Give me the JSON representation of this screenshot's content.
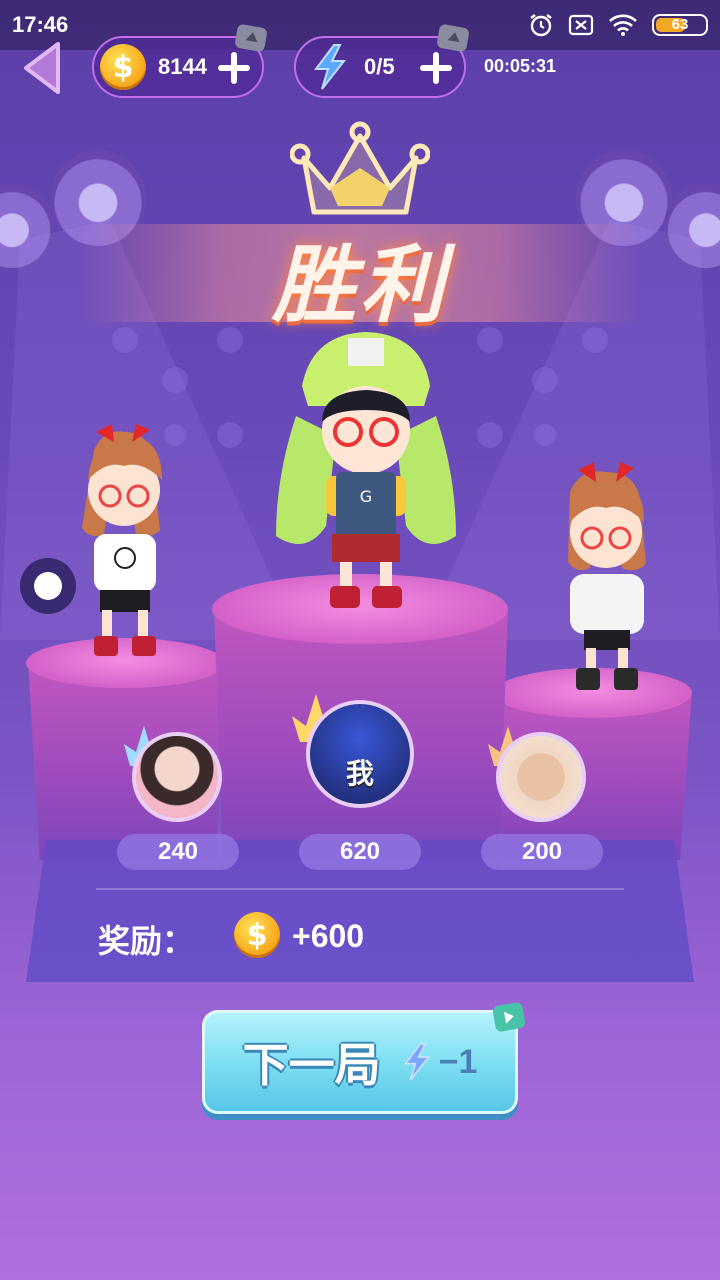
{
  "status_bar": {
    "time": "17:46",
    "battery": "63",
    "battery_level": 0.63
  },
  "top_bar": {
    "coins": "8144",
    "energy": "0/5",
    "timer": "00:05:31",
    "icons": [
      "back-arrow-icon",
      "coin-icon",
      "plus-icon",
      "lightning-icon"
    ]
  },
  "result": {
    "title": "胜利"
  },
  "players": [
    {
      "position": "left",
      "score": "240",
      "avatar": "girl-photo-avatar"
    },
    {
      "position": "center",
      "score": "620",
      "avatar_label": "我"
    },
    {
      "position": "right",
      "score": "200",
      "avatar": "cat-photo-avatar"
    }
  ],
  "reward": {
    "label": "奖励：",
    "value": "+600"
  },
  "next_button": {
    "label": "下一局",
    "cost": "−1"
  },
  "colors": {
    "accent": "#c26ee8",
    "coin": "#f7a417",
    "button": "#7fdff2",
    "title_glow": "#ff8a4f"
  }
}
